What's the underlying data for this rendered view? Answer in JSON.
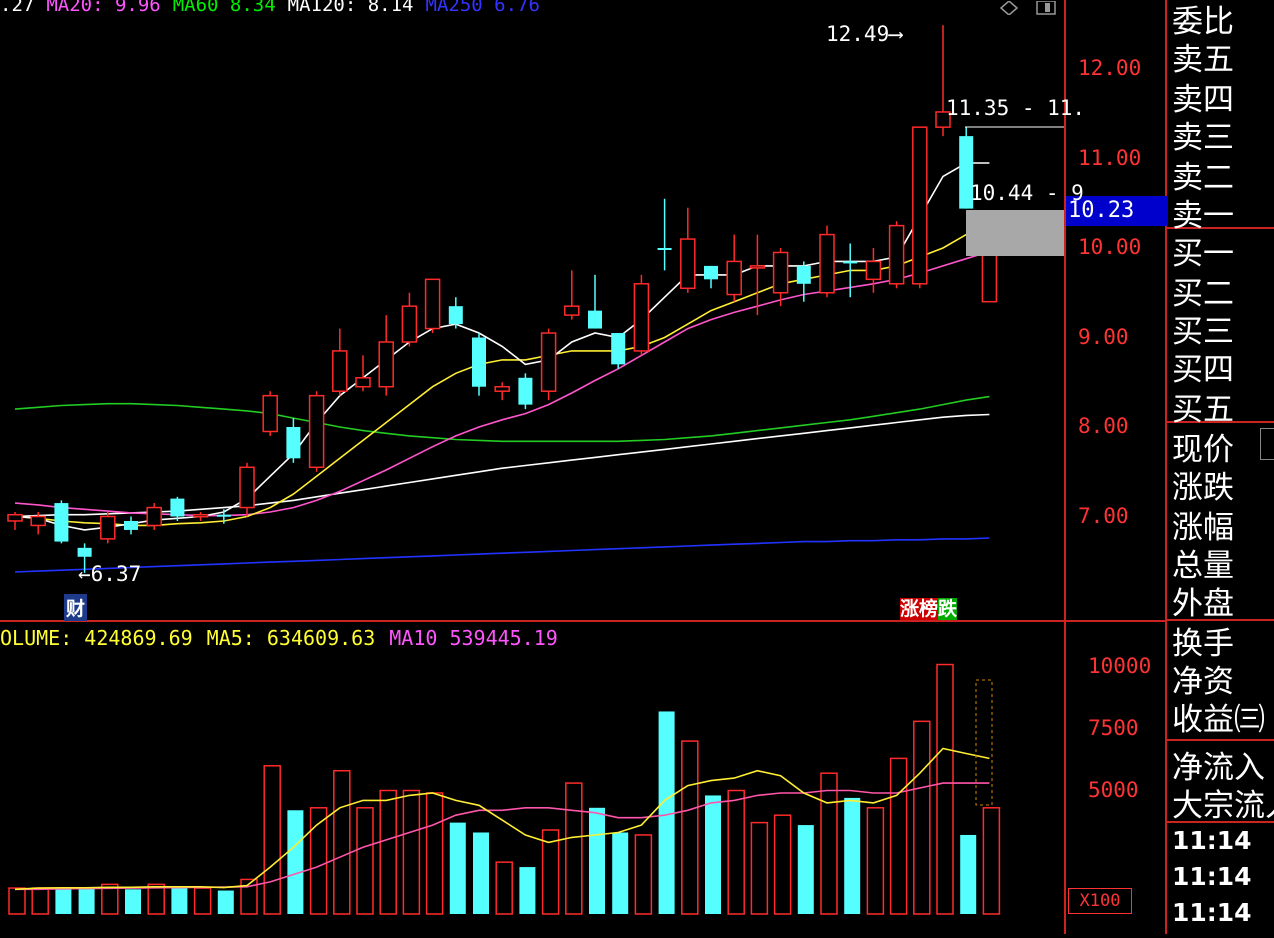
{
  "top_indicator": {
    "items": [
      {
        "text": ".27",
        "color": "#ffffff"
      },
      {
        "text": "MA20: 9.96",
        "color": "#ff55ff"
      },
      {
        "text": "MA60  8.34",
        "color": "#00ee00"
      },
      {
        "text": "MA120: 8.14",
        "color": "#ffffff"
      },
      {
        "text": "MA250  6.76",
        "color": "#3333ff"
      }
    ]
  },
  "price_axis": {
    "labels": [
      "12.00",
      "11.00",
      "10.00",
      "9.00",
      "8.00",
      "7.00"
    ],
    "current_price": "10.23"
  },
  "annotations": {
    "high_label": "12.49",
    "low_label": "6.37",
    "range_label_1": "11.35 - 11.",
    "range_label_2": "10.44 - 9"
  },
  "badges": {
    "cai": "财",
    "zhang": "涨",
    "bang": "榜",
    "die": "跌"
  },
  "volume_indicator": {
    "items": [
      {
        "text": "OLUME: 424869.69",
        "color": "#ffff33"
      },
      {
        "text": "MA5: 634609.63",
        "color": "#ffff33"
      },
      {
        "text": "MA10  539445.19",
        "color": "#ff55ff"
      }
    ]
  },
  "volume_axis": {
    "labels": [
      "10000",
      "7500",
      "5000"
    ],
    "unit": "X100"
  },
  "side_panel": {
    "labels": [
      "委比",
      "卖五",
      "卖四",
      "卖三",
      "卖二",
      "卖一",
      "买一",
      "买二",
      "买三",
      "买四",
      "买五",
      "现价",
      "涨跌",
      "涨幅",
      "总量",
      "外盘",
      "换手",
      "净资",
      "收益㈢",
      "净流入",
      "大宗流入"
    ],
    "times": [
      "11:14",
      "11:14",
      "11:14"
    ]
  },
  "chart_data": {
    "type": "candlestick",
    "y_price_range": [
      6.0,
      12.6
    ],
    "y_volume_range": [
      0,
      11000
    ],
    "candles": [
      {
        "o": 6.95,
        "h": 7.05,
        "l": 6.85,
        "c": 7.02,
        "up": true
      },
      {
        "o": 6.9,
        "h": 7.05,
        "l": 6.8,
        "c": 7.0,
        "up": true
      },
      {
        "o": 7.15,
        "h": 7.18,
        "l": 6.7,
        "c": 6.72,
        "up": false
      },
      {
        "o": 6.65,
        "h": 6.7,
        "l": 6.37,
        "c": 6.55,
        "up": false
      },
      {
        "o": 6.75,
        "h": 7.05,
        "l": 6.7,
        "c": 7.0,
        "up": true
      },
      {
        "o": 6.95,
        "h": 7.0,
        "l": 6.8,
        "c": 6.85,
        "up": false
      },
      {
        "o": 6.9,
        "h": 7.15,
        "l": 6.85,
        "c": 7.1,
        "up": true
      },
      {
        "o": 7.2,
        "h": 7.22,
        "l": 6.95,
        "c": 7.0,
        "up": false
      },
      {
        "o": 7.0,
        "h": 7.05,
        "l": 6.95,
        "c": 7.02,
        "up": true
      },
      {
        "o": 7.02,
        "h": 7.08,
        "l": 6.92,
        "c": 7.0,
        "up": false
      },
      {
        "o": 7.1,
        "h": 7.6,
        "l": 7.0,
        "c": 7.55,
        "up": true
      },
      {
        "o": 7.95,
        "h": 8.4,
        "l": 7.9,
        "c": 8.35,
        "up": true
      },
      {
        "o": 8.0,
        "h": 8.1,
        "l": 7.6,
        "c": 7.65,
        "up": false
      },
      {
        "o": 7.55,
        "h": 8.4,
        "l": 7.5,
        "c": 8.35,
        "up": true
      },
      {
        "o": 8.4,
        "h": 9.1,
        "l": 8.35,
        "c": 8.85,
        "up": true
      },
      {
        "o": 8.45,
        "h": 8.8,
        "l": 8.4,
        "c": 8.55,
        "up": true
      },
      {
        "o": 8.45,
        "h": 9.25,
        "l": 8.35,
        "c": 8.95,
        "up": true
      },
      {
        "o": 8.95,
        "h": 9.5,
        "l": 8.9,
        "c": 9.35,
        "up": true
      },
      {
        "o": 9.1,
        "h": 9.65,
        "l": 9.05,
        "c": 9.65,
        "up": true
      },
      {
        "o": 9.35,
        "h": 9.45,
        "l": 9.1,
        "c": 9.15,
        "up": false
      },
      {
        "o": 9.0,
        "h": 9.05,
        "l": 8.35,
        "c": 8.45,
        "up": false
      },
      {
        "o": 8.4,
        "h": 8.5,
        "l": 8.3,
        "c": 8.45,
        "up": true
      },
      {
        "o": 8.55,
        "h": 8.6,
        "l": 8.2,
        "c": 8.25,
        "up": false
      },
      {
        "o": 8.4,
        "h": 9.1,
        "l": 8.3,
        "c": 9.05,
        "up": true
      },
      {
        "o": 9.25,
        "h": 9.75,
        "l": 9.2,
        "c": 9.35,
        "up": true
      },
      {
        "o": 9.3,
        "h": 9.7,
        "l": 9.1,
        "c": 9.1,
        "up": false
      },
      {
        "o": 9.05,
        "h": 9.05,
        "l": 8.65,
        "c": 8.7,
        "up": false
      },
      {
        "o": 8.85,
        "h": 9.7,
        "l": 8.8,
        "c": 9.6,
        "up": true
      },
      {
        "o": 10.0,
        "h": 10.55,
        "l": 9.75,
        "c": 10.0,
        "up": false
      },
      {
        "o": 9.55,
        "h": 10.45,
        "l": 9.5,
        "c": 10.1,
        "up": true
      },
      {
        "o": 9.8,
        "h": 9.8,
        "l": 9.55,
        "c": 9.65,
        "up": false
      },
      {
        "o": 9.48,
        "h": 10.15,
        "l": 9.4,
        "c": 9.85,
        "up": true
      },
      {
        "o": 9.78,
        "h": 10.15,
        "l": 9.25,
        "c": 9.8,
        "up": true
      },
      {
        "o": 9.5,
        "h": 10.0,
        "l": 9.35,
        "c": 9.95,
        "up": true
      },
      {
        "o": 9.8,
        "h": 9.85,
        "l": 9.4,
        "c": 9.6,
        "up": false
      },
      {
        "o": 9.5,
        "h": 10.25,
        "l": 9.45,
        "c": 10.15,
        "up": true
      },
      {
        "o": 9.85,
        "h": 10.05,
        "l": 9.45,
        "c": 9.85,
        "up": false
      },
      {
        "o": 9.65,
        "h": 10.0,
        "l": 9.5,
        "c": 9.85,
        "up": true
      },
      {
        "o": 9.6,
        "h": 10.3,
        "l": 9.55,
        "c": 10.25,
        "up": true
      },
      {
        "o": 9.6,
        "h": 11.35,
        "l": 9.55,
        "c": 11.35,
        "up": true
      },
      {
        "o": 11.35,
        "h": 12.49,
        "l": 11.25,
        "c": 11.52,
        "up": true
      },
      {
        "o": 11.25,
        "h": 11.35,
        "l": 10.44,
        "c": 10.44,
        "up": false
      },
      {
        "o": 9.95,
        "h": 10.0,
        "l": 9.4,
        "c": 9.4,
        "up": true
      }
    ],
    "volumes": [
      {
        "v": 1050,
        "up": true
      },
      {
        "v": 1050,
        "up": true
      },
      {
        "v": 1050,
        "up": false
      },
      {
        "v": 1050,
        "up": false
      },
      {
        "v": 1200,
        "up": true
      },
      {
        "v": 1000,
        "up": false
      },
      {
        "v": 1200,
        "up": true
      },
      {
        "v": 1050,
        "up": false
      },
      {
        "v": 1050,
        "up": true
      },
      {
        "v": 950,
        "up": false
      },
      {
        "v": 1400,
        "up": true
      },
      {
        "v": 6000,
        "up": true
      },
      {
        "v": 4200,
        "up": false
      },
      {
        "v": 4300,
        "up": true
      },
      {
        "v": 5800,
        "up": true
      },
      {
        "v": 4300,
        "up": true
      },
      {
        "v": 5000,
        "up": true
      },
      {
        "v": 5000,
        "up": true
      },
      {
        "v": 4900,
        "up": true
      },
      {
        "v": 3700,
        "up": false
      },
      {
        "v": 3300,
        "up": false
      },
      {
        "v": 2100,
        "up": true
      },
      {
        "v": 1900,
        "up": false
      },
      {
        "v": 3400,
        "up": true
      },
      {
        "v": 5300,
        "up": true
      },
      {
        "v": 4300,
        "up": false
      },
      {
        "v": 3300,
        "up": false
      },
      {
        "v": 3200,
        "up": true
      },
      {
        "v": 8200,
        "up": false
      },
      {
        "v": 7000,
        "up": true
      },
      {
        "v": 4800,
        "up": false
      },
      {
        "v": 5000,
        "up": true
      },
      {
        "v": 3700,
        "up": true
      },
      {
        "v": 4000,
        "up": true
      },
      {
        "v": 3600,
        "up": false
      },
      {
        "v": 5700,
        "up": true
      },
      {
        "v": 4700,
        "up": false
      },
      {
        "v": 4300,
        "up": true
      },
      {
        "v": 6300,
        "up": true
      },
      {
        "v": 7800,
        "up": true
      },
      {
        "v": 10100,
        "up": true
      },
      {
        "v": 3200,
        "up": false
      },
      {
        "v": 4300,
        "up": true
      }
    ],
    "lines": {
      "ma5": [
        7.0,
        6.98,
        6.9,
        6.85,
        6.88,
        6.92,
        6.96,
        6.98,
        7.0,
        7.05,
        7.2,
        7.45,
        7.7,
        8.05,
        8.35,
        8.55,
        8.75,
        8.95,
        9.1,
        9.15,
        9.05,
        8.9,
        8.7,
        8.75,
        8.95,
        9.05,
        9.0,
        9.2,
        9.45,
        9.7,
        9.7,
        9.7,
        9.8,
        9.8,
        9.8,
        9.85,
        9.85,
        9.85,
        9.9,
        10.35,
        10.8,
        10.95,
        10.95
      ],
      "ma10": [
        7.0,
        6.98,
        6.95,
        6.93,
        6.92,
        6.9,
        6.9,
        6.92,
        6.93,
        6.95,
        7.0,
        7.1,
        7.25,
        7.45,
        7.65,
        7.85,
        8.05,
        8.25,
        8.45,
        8.6,
        8.7,
        8.75,
        8.75,
        8.8,
        8.85,
        8.85,
        8.85,
        8.9,
        9.0,
        9.15,
        9.3,
        9.4,
        9.5,
        9.6,
        9.65,
        9.7,
        9.75,
        9.75,
        9.8,
        9.9,
        10.0,
        10.15,
        10.25
      ],
      "ma20": [
        7.15,
        7.13,
        7.1,
        7.08,
        7.06,
        7.04,
        7.03,
        7.02,
        7.01,
        7.01,
        7.02,
        7.05,
        7.1,
        7.18,
        7.28,
        7.4,
        7.52,
        7.65,
        7.78,
        7.9,
        8.0,
        8.08,
        8.15,
        8.25,
        8.38,
        8.52,
        8.65,
        8.8,
        8.95,
        9.1,
        9.2,
        9.28,
        9.35,
        9.42,
        9.48,
        9.52,
        9.56,
        9.6,
        9.65,
        9.72,
        9.8,
        9.88,
        9.96
      ],
      "ma60": [
        8.2,
        8.22,
        8.24,
        8.25,
        8.26,
        8.26,
        8.25,
        8.24,
        8.22,
        8.2,
        8.18,
        8.15,
        8.1,
        8.05,
        8.0,
        7.96,
        7.93,
        7.9,
        7.88,
        7.86,
        7.85,
        7.84,
        7.84,
        7.84,
        7.84,
        7.84,
        7.84,
        7.85,
        7.86,
        7.88,
        7.9,
        7.93,
        7.96,
        7.99,
        8.02,
        8.05,
        8.08,
        8.12,
        8.16,
        8.2,
        8.25,
        8.3,
        8.34
      ],
      "ma120": [
        7.0,
        7.01,
        7.02,
        7.02,
        7.03,
        7.04,
        7.05,
        7.06,
        7.08,
        7.1,
        7.12,
        7.15,
        7.18,
        7.22,
        7.26,
        7.3,
        7.34,
        7.38,
        7.42,
        7.46,
        7.5,
        7.54,
        7.57,
        7.6,
        7.63,
        7.66,
        7.69,
        7.72,
        7.75,
        7.78,
        7.81,
        7.84,
        7.87,
        7.9,
        7.93,
        7.96,
        7.99,
        8.02,
        8.05,
        8.08,
        8.11,
        8.13,
        8.14
      ],
      "ma250": [
        6.38,
        6.39,
        6.4,
        6.41,
        6.42,
        6.43,
        6.44,
        6.45,
        6.46,
        6.47,
        6.48,
        6.49,
        6.5,
        6.51,
        6.52,
        6.53,
        6.54,
        6.55,
        6.56,
        6.57,
        6.58,
        6.59,
        6.6,
        6.61,
        6.62,
        6.63,
        6.64,
        6.65,
        6.66,
        6.67,
        6.68,
        6.69,
        6.7,
        6.71,
        6.72,
        6.72,
        6.73,
        6.73,
        6.74,
        6.74,
        6.75,
        6.75,
        6.76
      ],
      "vol_ma5": [
        1000,
        1050,
        1060,
        1060,
        1080,
        1080,
        1100,
        1100,
        1100,
        1070,
        1150,
        1900,
        2700,
        3600,
        4300,
        4600,
        4600,
        4800,
        4900,
        4600,
        4400,
        3800,
        3200,
        2900,
        3100,
        3200,
        3300,
        3600,
        4600,
        5200,
        5400,
        5500,
        5800,
        5600,
        4900,
        4500,
        4600,
        4500,
        4800,
        5700,
        6700,
        6500,
        6300
      ],
      "vol_ma10": [
        1000,
        1000,
        1020,
        1030,
        1040,
        1050,
        1060,
        1070,
        1080,
        1090,
        1100,
        1300,
        1600,
        1900,
        2300,
        2700,
        3000,
        3300,
        3600,
        4000,
        4200,
        4200,
        4300,
        4300,
        4200,
        4100,
        3900,
        3900,
        4000,
        4200,
        4500,
        4600,
        4800,
        4900,
        4900,
        5000,
        5000,
        4900,
        4900,
        5100,
        5300,
        5300,
        5300
      ]
    }
  }
}
